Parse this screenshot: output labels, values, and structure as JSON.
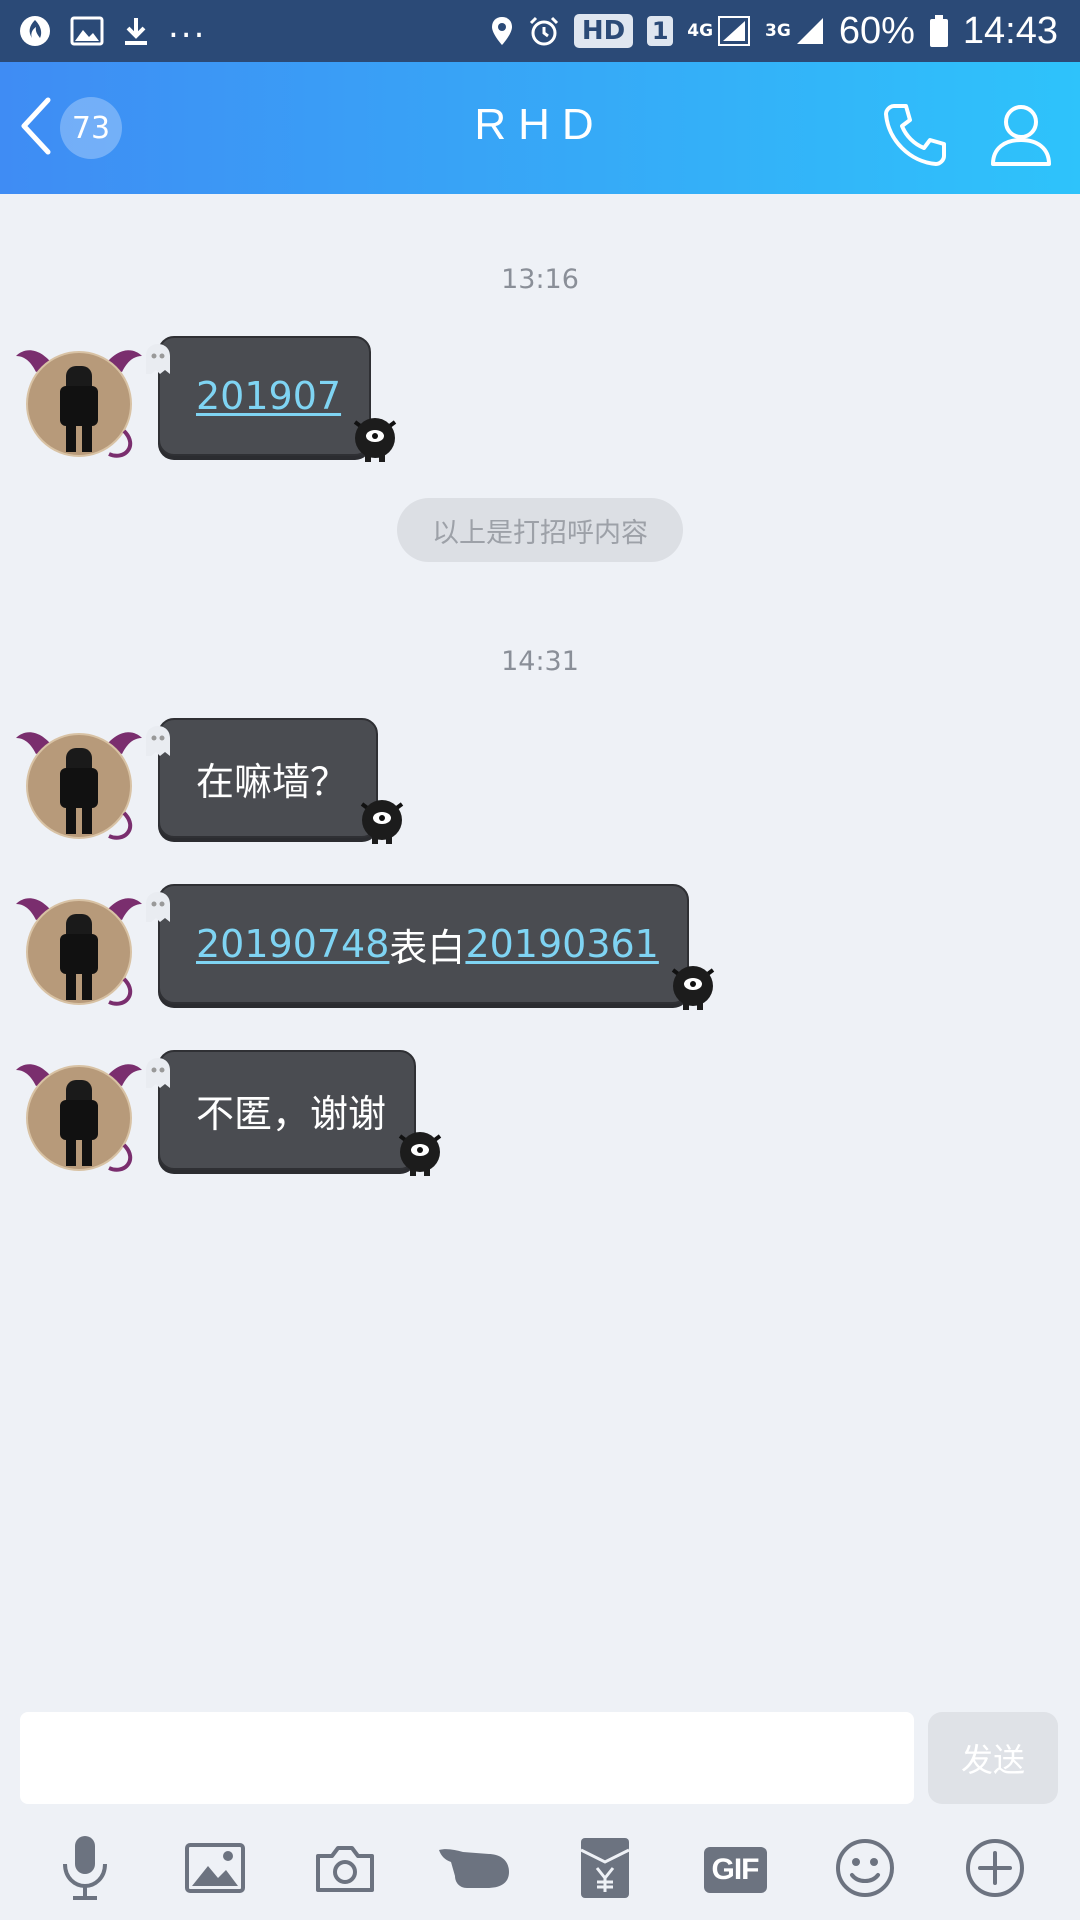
{
  "status_bar": {
    "icons_left": [
      "app-notification-icon",
      "image-icon",
      "download-icon"
    ],
    "overflow": "...",
    "hd": "HD",
    "sim": "1",
    "net1": "4G",
    "net2": "3G",
    "battery": "60%",
    "time": "14:43"
  },
  "header": {
    "unread_count": "73",
    "title": "RHD",
    "icons": [
      "back-chevron-icon",
      "phone-icon",
      "profile-icon"
    ]
  },
  "chat": {
    "timestamps": [
      "13:16",
      "14:31"
    ],
    "system_notice": "以上是打招呼内容",
    "messages": [
      {
        "parts": [
          {
            "text": "201907",
            "link": true
          }
        ]
      },
      {
        "parts": [
          {
            "text": "在嘛墙？",
            "link": false
          }
        ]
      },
      {
        "parts": [
          {
            "text": "20190748",
            "link": true
          },
          {
            "text": "表白",
            "link": false
          },
          {
            "text": "20190361",
            "link": true
          }
        ]
      },
      {
        "parts": [
          {
            "text": "不匿，谢谢",
            "link": false
          }
        ]
      }
    ]
  },
  "composer": {
    "input_value": "",
    "send_label": "发送"
  },
  "toolbar": {
    "items": [
      "microphone-icon",
      "image-icon",
      "camera-icon",
      "poke-icon",
      "red-packet-icon",
      "gif-icon",
      "emoji-icon",
      "plus-icon"
    ],
    "gif_label": "GIF"
  },
  "colors": {
    "header_start": "#3f8cf4",
    "header_end": "#2ec3fb",
    "bubble": "#4a4c51",
    "link": "#7fd4f3",
    "background": "#eef1f6"
  }
}
